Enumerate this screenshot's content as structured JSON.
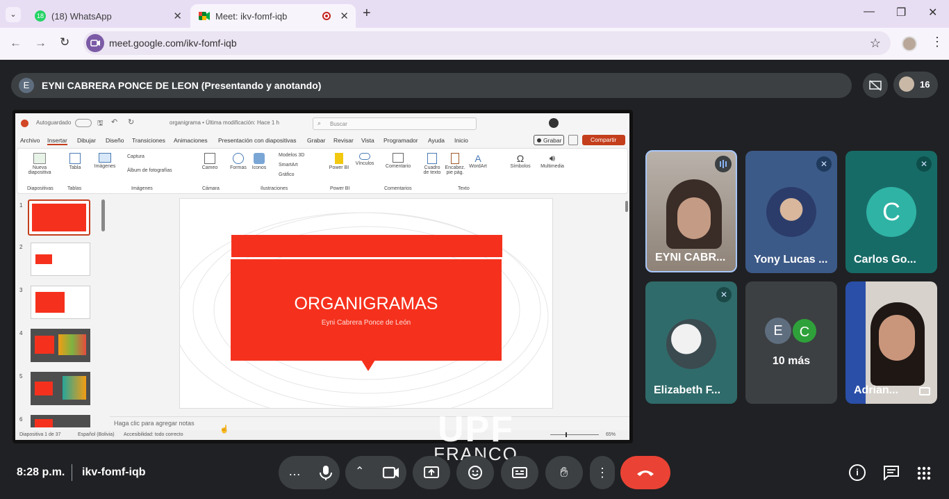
{
  "browser": {
    "tabs": [
      {
        "badge": "18",
        "label": "(18) WhatsApp"
      },
      {
        "label": "Meet: ikv-fomf-iqb"
      }
    ],
    "new_tab": "+",
    "url": "meet.google.com/ikv-fomf-iqb"
  },
  "meet": {
    "presenter_initial": "E",
    "presenter_label": "EYNI CABRERA PONCE DE LEON (Presentando y anotando)",
    "participant_count": "16",
    "time": "8:28 p.m.",
    "meeting_code": "ikv-fomf-iqb",
    "participants": [
      {
        "name": "EYNI CABR...",
        "initial": ""
      },
      {
        "name": "Yony Lucas ...",
        "initial": ""
      },
      {
        "name": "Carlos Go...",
        "initial": "C"
      },
      {
        "name": "Elizabeth F...",
        "initial": ""
      },
      {
        "name": "10 más",
        "initial": ""
      },
      {
        "name": "Adrian...",
        "initial": ""
      }
    ],
    "more_initials": [
      "E",
      "C"
    ],
    "accent_red": "#ea4335"
  },
  "ppt": {
    "autosave": "Autoguardado",
    "filename": "organigrama • Última modificación: Hace 1 h",
    "search": "Buscar",
    "menu": [
      "Archivo",
      "Insertar",
      "Dibujar",
      "Diseño",
      "Transiciones",
      "Animaciones",
      "Presentación con diapositivas",
      "Grabar",
      "Revisar",
      "Vista",
      "Programador",
      "Ayuda",
      "Inicio"
    ],
    "record_btn": "Grabar",
    "share_btn": "Compartir",
    "ribbon": [
      {
        "label": "Nueva diapositiva",
        "group": "Diapositivas"
      },
      {
        "label": "Tabla",
        "group": "Tablas"
      },
      {
        "label": "Imágenes",
        "group": "Imágenes"
      },
      {
        "label": "Captura",
        "group": ""
      },
      {
        "label": "Álbum de fotografías",
        "group": ""
      },
      {
        "label": "Cameo",
        "group": "Cámara"
      },
      {
        "label": "Formas",
        "group": "Ilustraciones"
      },
      {
        "label": "Iconos",
        "group": ""
      },
      {
        "label": "Modelos 3D",
        "group": ""
      },
      {
        "label": "SmartArt",
        "group": ""
      },
      {
        "label": "Gráfico",
        "group": ""
      },
      {
        "label": "Power BI",
        "group": "Power BI"
      },
      {
        "label": "Vínculos",
        "group": ""
      },
      {
        "label": "Comentario",
        "group": "Comentarios"
      },
      {
        "label": "Cuadro de texto",
        "group": "Texto"
      },
      {
        "label": "Encabez. pie pág.",
        "group": ""
      },
      {
        "label": "WordArt",
        "group": ""
      },
      {
        "label": "Símbolos",
        "group": ""
      },
      {
        "label": "Multimedia",
        "group": ""
      }
    ],
    "slide_numbers": [
      "1",
      "2",
      "3",
      "4",
      "5",
      "6"
    ],
    "slide_title": "ORGANIGRAMAS",
    "slide_subtitle": "Eyni Cabrera Ponce de León",
    "notes": "Haga clic para agregar notas",
    "status_slide": "Diapositiva 1 de 37",
    "status_lang": "Español (Bolivia)",
    "status_access": "Accesibilidad: todo correcto",
    "zoom": "65%"
  },
  "watermark": {
    "line1": "UPF",
    "line2": "FRANCO"
  }
}
